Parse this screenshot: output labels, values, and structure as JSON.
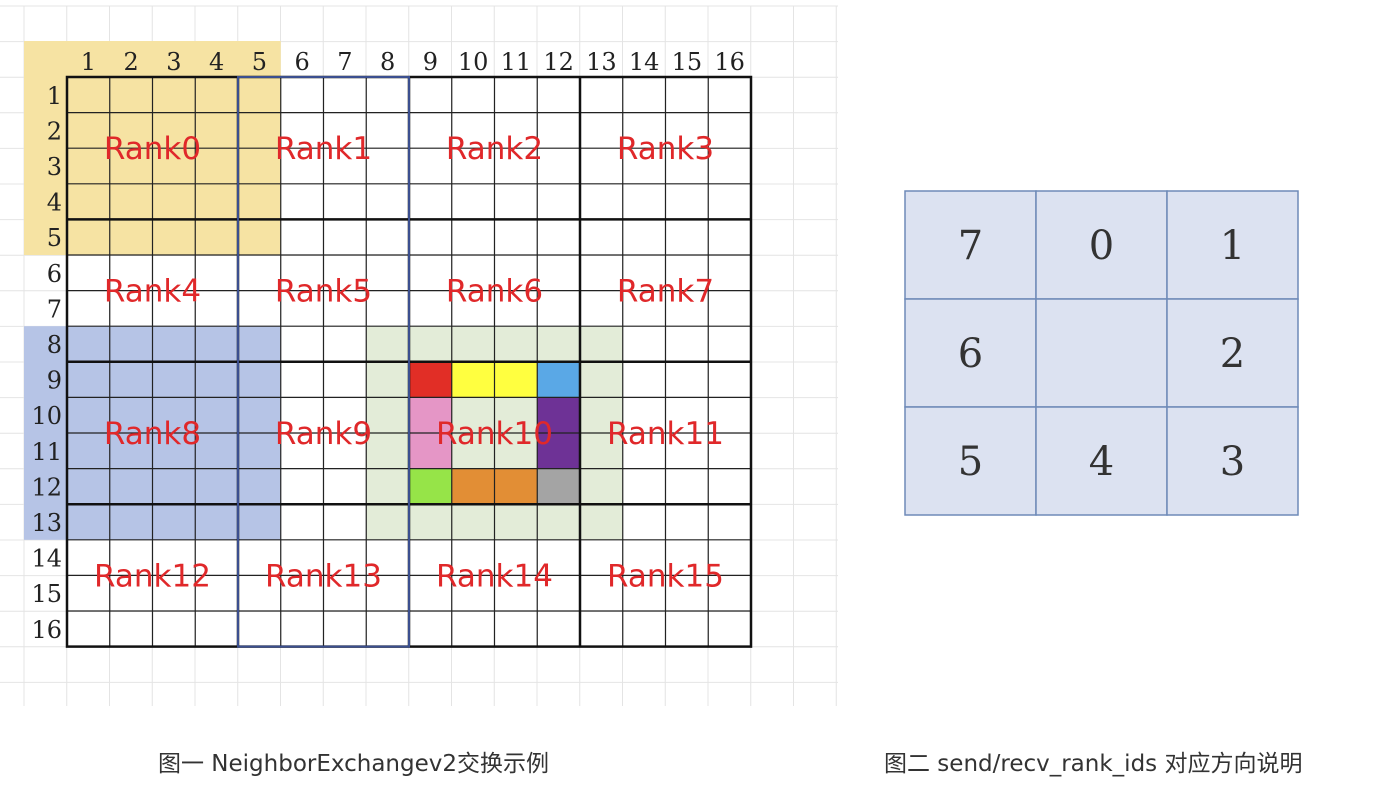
{
  "figure1": {
    "caption": "图一 NeighborExchangev2交换示例",
    "col_numbers": [
      "1",
      "2",
      "3",
      "4",
      "5",
      "6",
      "7",
      "8",
      "9",
      "10",
      "11",
      "12",
      "13",
      "14",
      "15",
      "16"
    ],
    "row_numbers": [
      "1",
      "2",
      "3",
      "4",
      "5",
      "6",
      "7",
      "8",
      "9",
      "10",
      "11",
      "12",
      "13",
      "14",
      "15",
      "16"
    ],
    "rank_labels": [
      "Rank0",
      "Rank1",
      "Rank2",
      "Rank3",
      "Rank4",
      "Rank5",
      "Rank6",
      "Rank7",
      "Rank8",
      "Rank9",
      "Rank10",
      "Rank11",
      "Rank12",
      "Rank13",
      "Rank14",
      "Rank15"
    ],
    "colors": {
      "label": "#e0282a",
      "yellow_region": "#f6e3a3",
      "blue_region": "#b6c4e6",
      "green_region": "#e3ecd8",
      "red": "#e12e26",
      "yellow": "#ffff40",
      "sky": "#5aa8e6",
      "pink": "#e596c6",
      "purple": "#6e3296",
      "lime": "#96e448",
      "orange": "#e28e35",
      "gray": "#a4a4a4"
    }
  },
  "figure2": {
    "caption": "图二 send/recv_rank_ids 对应方向说明",
    "cells": [
      "7",
      "0",
      "1",
      "6",
      "",
      "2",
      "5",
      "4",
      "3"
    ],
    "colors": {
      "fill": "#dce2f1",
      "border": "#6e8ab8"
    }
  }
}
